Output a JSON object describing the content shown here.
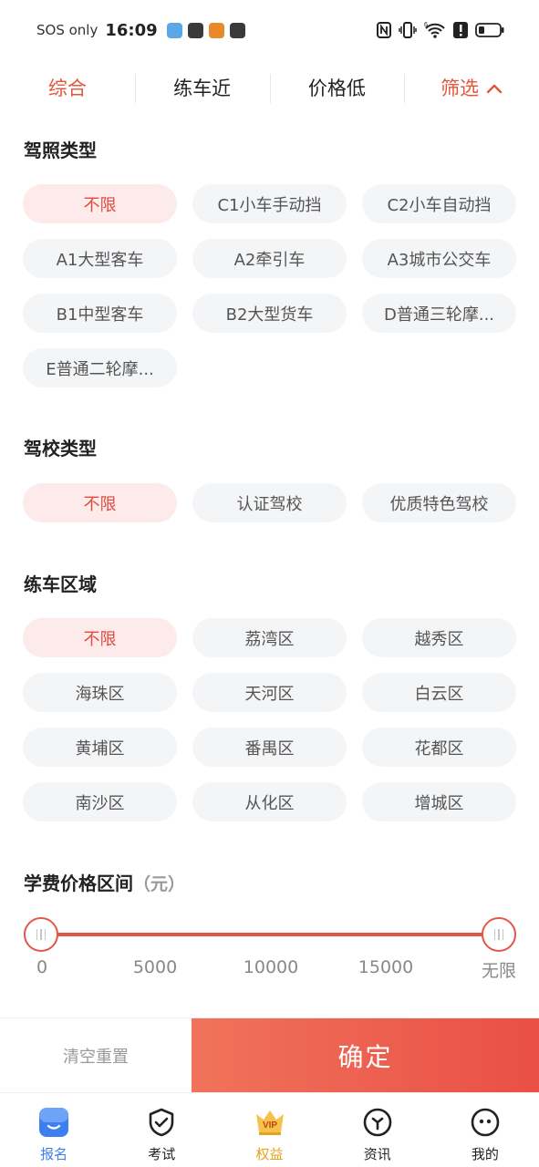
{
  "status_bar": {
    "carrier": "SOS only",
    "time": "16:09",
    "network_label": "6"
  },
  "sort_tabs": [
    {
      "label": "综合",
      "active": true
    },
    {
      "label": "练车近",
      "active": false
    },
    {
      "label": "价格低",
      "active": false
    },
    {
      "label": "筛选",
      "active": false
    }
  ],
  "license": {
    "title": "驾照类型",
    "options": [
      "不限",
      "C1小车手动挡",
      "C2小车自动挡",
      "A1大型客车",
      "A2牵引车",
      "A3城市公交车",
      "B1中型客车",
      "B2大型货车",
      "D普通三轮摩...",
      "E普通二轮摩..."
    ]
  },
  "school": {
    "title": "驾校类型",
    "options": [
      "不限",
      "认证驾校",
      "优质特色驾校"
    ]
  },
  "region": {
    "title": "练车区域",
    "options": [
      "不限",
      "荔湾区",
      "越秀区",
      "海珠区",
      "天河区",
      "白云区",
      "黄埔区",
      "番禺区",
      "花都区",
      "南沙区",
      "从化区",
      "增城区"
    ]
  },
  "price": {
    "title": "学费价格区间",
    "unit": "（元）",
    "ticks": [
      "0",
      "5000",
      "10000",
      "15000",
      "无限"
    ],
    "range_low": 0,
    "range_high": "无限"
  },
  "actions": {
    "reset_label": "清空重置",
    "confirm_label": "确定"
  },
  "tab_bar": [
    {
      "label": "报名",
      "icon": "signup-icon"
    },
    {
      "label": "考试",
      "icon": "exam-shield-icon"
    },
    {
      "label": "权益",
      "icon": "vip-crown-icon",
      "badge": "VIP"
    },
    {
      "label": "资讯",
      "icon": "news-icon"
    },
    {
      "label": "我的",
      "icon": "profile-face-icon"
    }
  ],
  "colors": {
    "accent": "#e2563b",
    "selected_chip_bg": "#fdeaea",
    "confirm_start": "#f0735a",
    "confirm_end": "#ea4f46",
    "tab_active": "#3d7ef0",
    "vip": "#e6a21d"
  }
}
